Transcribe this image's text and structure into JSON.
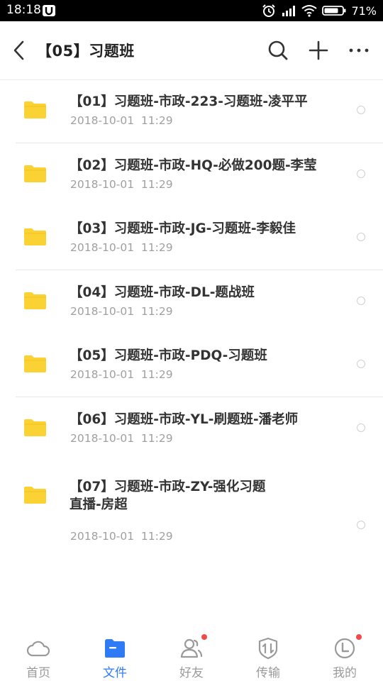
{
  "status_bar": {
    "time": "18:18",
    "battery": "71%"
  },
  "header": {
    "title": "【05】习题班"
  },
  "files": [
    {
      "name": "【01】习题班-市政-223-习题班-凌平平",
      "date": "2018-10-01  11:29"
    },
    {
      "name": "【02】习题班-市政-HQ-必做200题-李莹",
      "date": "2018-10-01  11:29"
    },
    {
      "name": "【03】习题班-市政-JG-习题班-李毅佳",
      "date": "2018-10-01  11:29"
    },
    {
      "name": "【04】习题班-市政-DL-题战班",
      "date": "2018-10-01  11:29"
    },
    {
      "name": "【05】习题班-市政-PDQ-习题班",
      "date": "2018-10-01  11:29"
    },
    {
      "name": "【06】习题班-市政-YL-刷题班-潘老师",
      "date": "2018-10-01  11:29"
    },
    {
      "name_line1": "【07】习题班-市政-ZY-强化习题",
      "name_line2": "直播-房超",
      "date": "2018-10-01  11:29"
    }
  ],
  "bottom_nav": [
    {
      "label": "首页",
      "icon": "cloud-icon"
    },
    {
      "label": "文件",
      "icon": "folder-icon",
      "active": true
    },
    {
      "label": "好友",
      "icon": "friends-icon"
    },
    {
      "label": "传输",
      "icon": "transfer-icon"
    },
    {
      "label": "我的",
      "icon": "profile-icon"
    }
  ],
  "colors": {
    "accent": "#2f7bf5",
    "folder": "#fbd234",
    "badge": "#f04b4b"
  }
}
